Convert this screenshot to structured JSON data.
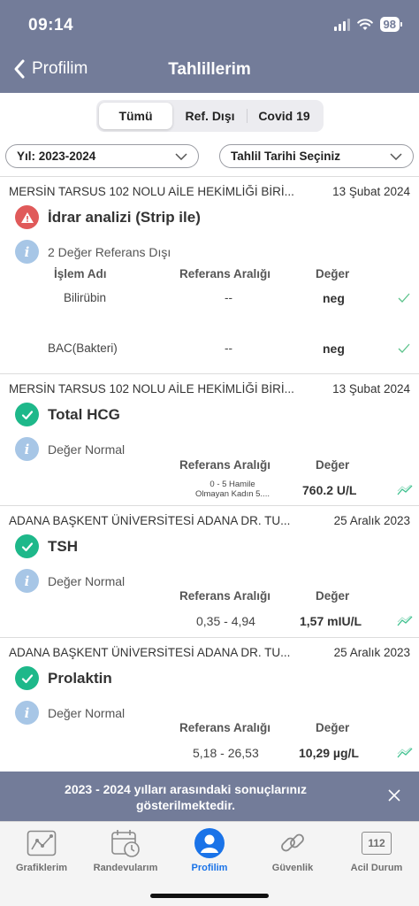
{
  "status": {
    "time": "09:14",
    "battery": "98"
  },
  "nav": {
    "back_label": "Profilim",
    "title": "Tahlillerim"
  },
  "segments": [
    {
      "label": "Tümü",
      "active": true
    },
    {
      "label": "Ref. Dışı",
      "active": false
    },
    {
      "label": "Covid 19",
      "active": false
    }
  ],
  "filters": {
    "year": "Yıl: 2023-2024",
    "date": "Tahlil Tarihi Seçiniz"
  },
  "results": [
    {
      "clinic": "MERSİN TARSUS 102 NOLU AİLE HEKİMLİĞİ BİRİ...",
      "date": "13 Şubat 2024",
      "status": "warning",
      "test": "İdrar analizi (Strip ile)",
      "note": "2 Değer Referans Dışı",
      "headers": {
        "name": "İşlem Adı",
        "ref": "Referans Aralığı",
        "value": "Değer"
      },
      "rows": [
        {
          "name": "Bilirübin",
          "ref": "--",
          "value": "neg"
        },
        {
          "name": "BAC(Bakteri)",
          "ref": "--",
          "value": "neg"
        }
      ]
    },
    {
      "clinic": "MERSİN TARSUS 102 NOLU AİLE HEKİMLİĞİ BİRİ...",
      "date": "13 Şubat 2024",
      "status": "ok",
      "test": "Total HCG",
      "note": "Değer Normal",
      "headers": {
        "ref": "Referans Aralığı",
        "value": "Değer"
      },
      "ref_line1": "0 - 5   Hamile",
      "ref_line2": "Olmayan Kadın    5....",
      "value": "760.2 U/L"
    },
    {
      "clinic": "ADANA BAŞKENT ÜNİVERSİTESİ ADANA DR. TU...",
      "date": "25 Aralık 2023",
      "status": "ok",
      "test": "TSH",
      "note": "Değer Normal",
      "headers": {
        "ref": "Referans Aralığı",
        "value": "Değer"
      },
      "ref": "0,35 - 4,94",
      "value": "1,57 mIU/L"
    },
    {
      "clinic": "ADANA BAŞKENT ÜNİVERSİTESİ ADANA DR. TU...",
      "date": "25 Aralık 2023",
      "status": "ok",
      "test": "Prolaktin",
      "note": "Değer Normal",
      "headers": {
        "ref": "Referans Aralığı",
        "value": "Değer"
      },
      "ref": "5,18 - 26,53",
      "value": "10,29 µg/L"
    }
  ],
  "toast": {
    "message": "2023 - 2024 yılları arasındaki sonuçlarınız gösterilmektedir."
  },
  "tabs": [
    {
      "label": "Grafiklerim",
      "icon": "chart-icon"
    },
    {
      "label": "Randevularım",
      "icon": "calendar-icon"
    },
    {
      "label": "Profilim",
      "icon": "profile-icon",
      "active": true
    },
    {
      "label": "Güvenlik",
      "icon": "link-icon"
    },
    {
      "label": "Acil Durum",
      "icon": "emergency-112-icon",
      "icon_text": "112"
    }
  ],
  "colors": {
    "header": "#737c99",
    "accent_blue": "#1a73e8",
    "ok_green": "#1eb88a",
    "warning_red": "#e05a5a",
    "info_blue": "#a7c6e6",
    "trend_green": "#3fc18f"
  }
}
